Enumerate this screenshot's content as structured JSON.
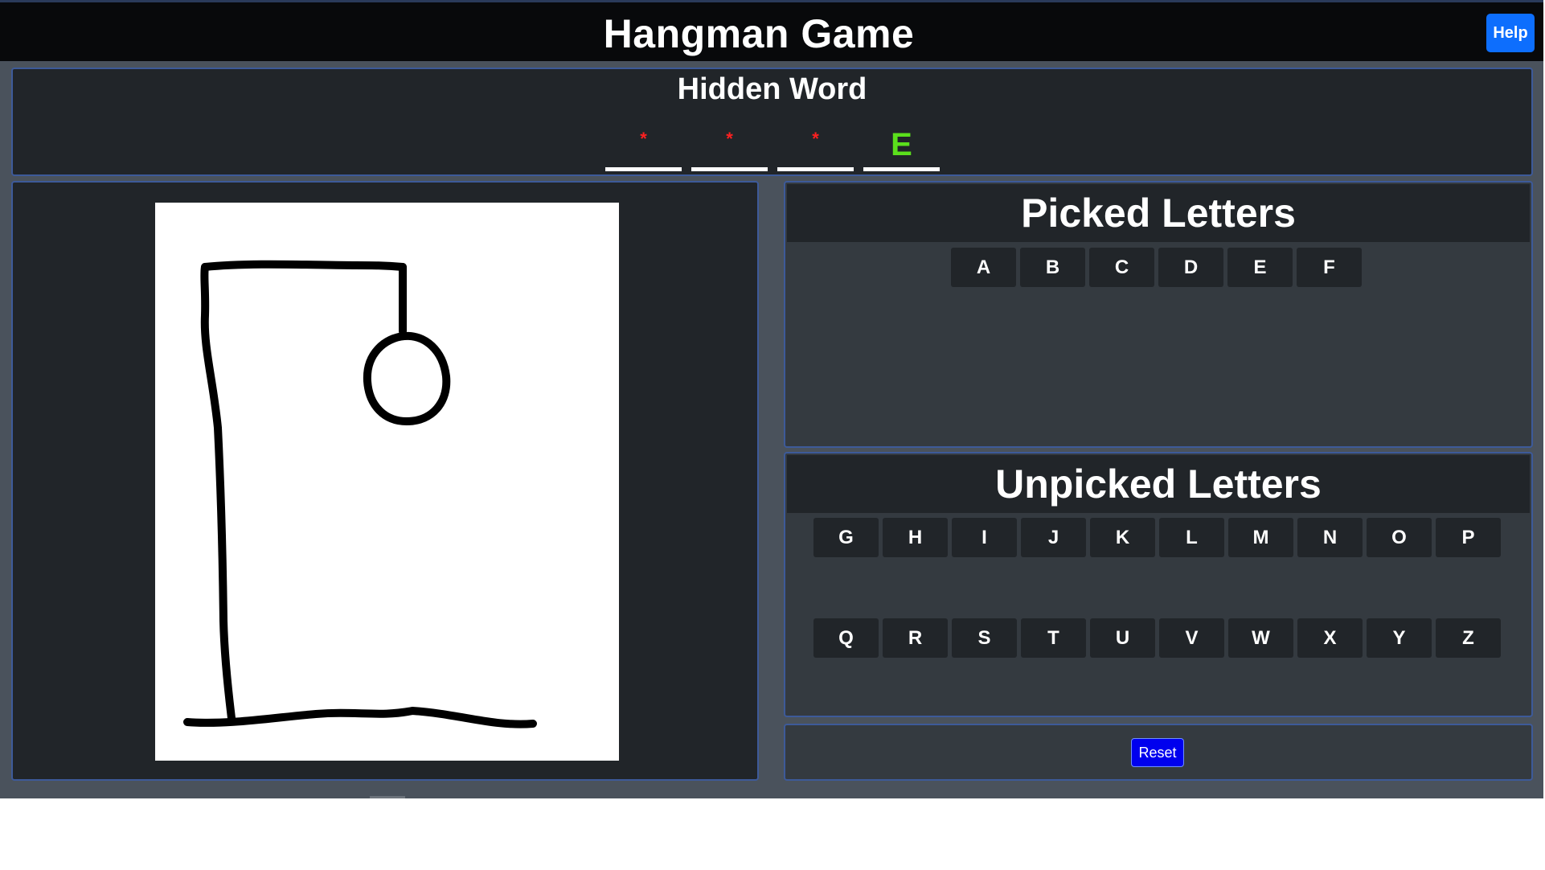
{
  "header": {
    "title": "Hangman Game",
    "help_label": "Help"
  },
  "hidden_word": {
    "title": "Hidden Word",
    "slots": [
      {
        "display": "*",
        "revealed": false
      },
      {
        "display": "*",
        "revealed": false
      },
      {
        "display": "*",
        "revealed": false
      },
      {
        "display": "E",
        "revealed": true
      }
    ]
  },
  "gallows": {
    "stage": 1,
    "parts_shown": [
      "gallows",
      "head"
    ]
  },
  "picked": {
    "title": "Picked Letters",
    "letters": [
      "A",
      "B",
      "C",
      "D",
      "E",
      "F"
    ]
  },
  "unpicked": {
    "title": "Unpicked Letters",
    "rows": [
      [
        "G",
        "H",
        "I",
        "J",
        "K",
        "L",
        "M",
        "N",
        "O",
        "P"
      ],
      [
        "Q",
        "R",
        "S",
        "T",
        "U",
        "V",
        "W",
        "X",
        "Y",
        "Z"
      ]
    ]
  },
  "controls": {
    "reset_label": "Reset"
  },
  "colors": {
    "header_bg": "#08090b",
    "panel_bg": "#212529",
    "letters_panel_bg": "#343a40",
    "panel_border": "#3d5a99",
    "help_button": "#0d6efd",
    "reset_button": "#0000ee",
    "hidden_marker": "#ff2020",
    "revealed_letter": "#5be01c"
  }
}
